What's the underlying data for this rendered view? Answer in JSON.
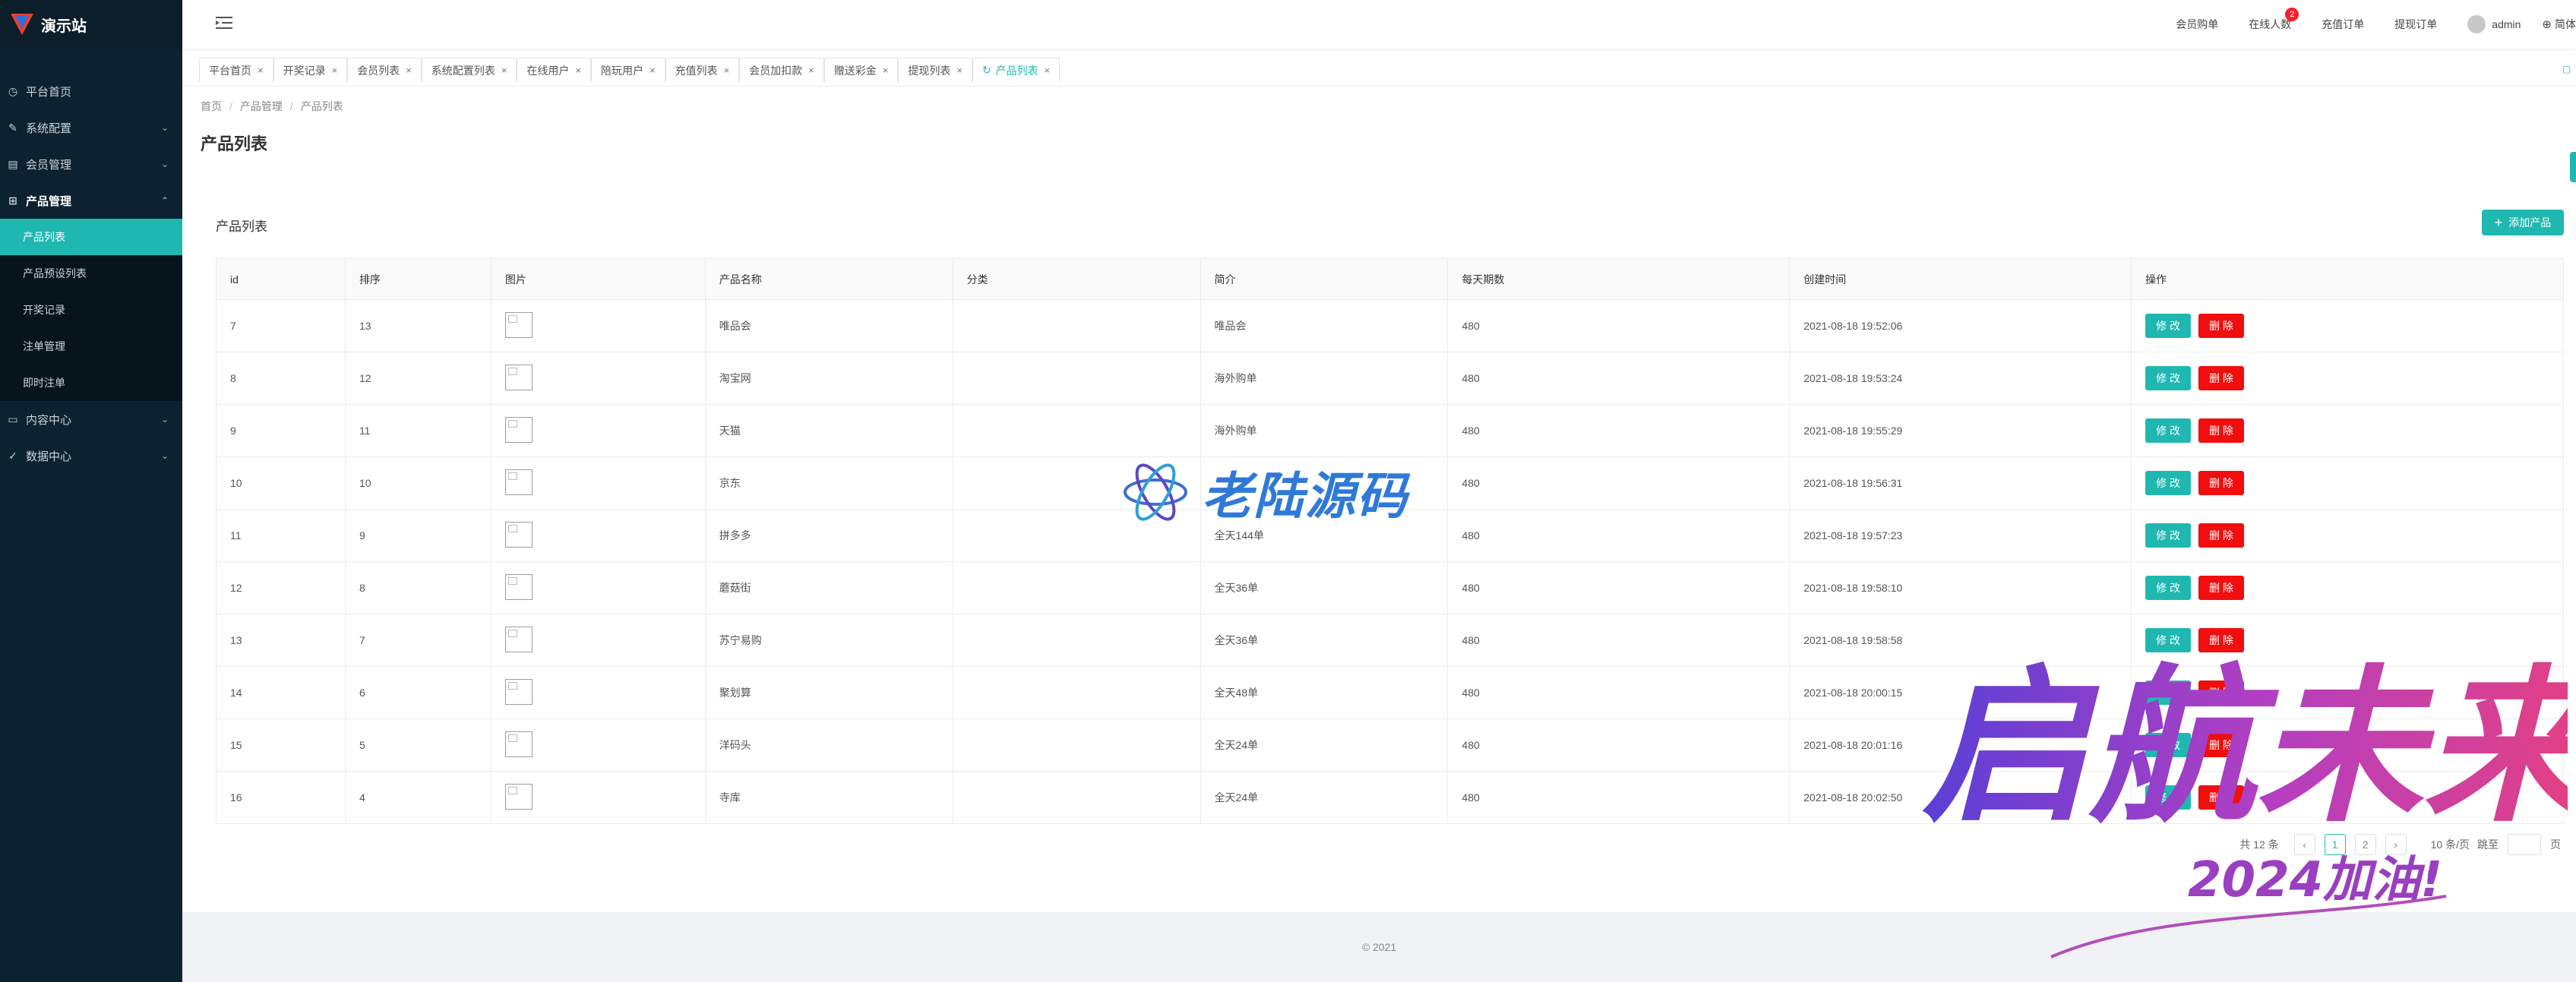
{
  "app": {
    "title": "演示站"
  },
  "sidebar": {
    "items": [
      {
        "label": "平台首页",
        "icon": "dashboard-icon"
      },
      {
        "label": "系统配置",
        "icon": "edit-icon"
      },
      {
        "label": "会员管理",
        "icon": "table-icon"
      },
      {
        "label": "产品管理",
        "icon": "grid-icon"
      },
      {
        "label": "内容中心",
        "icon": "book-icon"
      },
      {
        "label": "数据中心",
        "icon": "check-circle-icon"
      }
    ],
    "sub_items": [
      "产品列表",
      "产品预设列表",
      "开奖记录",
      "注单管理",
      "即时注单"
    ]
  },
  "topbar": {
    "links": [
      "会员购单",
      "在线人数",
      "充值订单",
      "提现订单"
    ],
    "online_badge": "2",
    "username": "admin",
    "lang_label": "简体"
  },
  "tabs": [
    "平台首页",
    "开奖记录",
    "会员列表",
    "系统配置列表",
    "在线用户",
    "陪玩用户",
    "充值列表",
    "会员加扣款",
    "赠送彩金",
    "提现列表",
    "产品列表"
  ],
  "breadcrumb": [
    "首页",
    "产品管理",
    "产品列表"
  ],
  "page": {
    "title": "产品列表",
    "card_title": "产品列表",
    "add_button": "添加产品"
  },
  "table": {
    "headers": [
      "id",
      "排序",
      "图片",
      "产品名称",
      "分类",
      "简介",
      "每天期数",
      "创建时间",
      "操作"
    ],
    "edit_label": "修 改",
    "delete_label": "删 除",
    "rows": [
      {
        "id": "7",
        "sort": "13",
        "name": "唯品会",
        "category": "",
        "intro": "唯品会",
        "periods": "480",
        "created": "2021-08-18 19:52:06"
      },
      {
        "id": "8",
        "sort": "12",
        "name": "淘宝网",
        "category": "",
        "intro": "海外购单",
        "periods": "480",
        "created": "2021-08-18 19:53:24"
      },
      {
        "id": "9",
        "sort": "11",
        "name": "天猫",
        "category": "",
        "intro": "海外购单",
        "periods": "480",
        "created": "2021-08-18 19:55:29"
      },
      {
        "id": "10",
        "sort": "10",
        "name": "京东",
        "category": "",
        "intro": "",
        "periods": "480",
        "created": "2021-08-18 19:56:31"
      },
      {
        "id": "11",
        "sort": "9",
        "name": "拼多多",
        "category": "",
        "intro": "全天144单",
        "periods": "480",
        "created": "2021-08-18 19:57:23"
      },
      {
        "id": "12",
        "sort": "8",
        "name": "蘑菇街",
        "category": "",
        "intro": "全天36单",
        "periods": "480",
        "created": "2021-08-18 19:58:10"
      },
      {
        "id": "13",
        "sort": "7",
        "name": "苏宁易购",
        "category": "",
        "intro": "全天36单",
        "periods": "480",
        "created": "2021-08-18 19:58:58"
      },
      {
        "id": "14",
        "sort": "6",
        "name": "聚划算",
        "category": "",
        "intro": "全天48单",
        "periods": "480",
        "created": "2021-08-18 20:00:15"
      },
      {
        "id": "15",
        "sort": "5",
        "name": "洋码头",
        "category": "",
        "intro": "全天24单",
        "periods": "480",
        "created": "2021-08-18 20:01:16"
      },
      {
        "id": "16",
        "sort": "4",
        "name": "寺库",
        "category": "",
        "intro": "全天24单",
        "periods": "480",
        "created": "2021-08-18 20:02:50"
      }
    ]
  },
  "pagination": {
    "total": "共 12 条",
    "current_page": "1",
    "next_page": "2",
    "page_size": "10 条/页",
    "jump_label": "跳至",
    "page_unit": "页"
  },
  "footer": {
    "copyright": "© 2021"
  },
  "watermarks": {
    "center_text": "老陆源码",
    "art_text": "启航未来",
    "art_subtext": "2024加油!"
  },
  "colors": {
    "accent": "#1fb8b1",
    "danger": "#f10e0e",
    "sidebar_bg": "#0d2230"
  }
}
